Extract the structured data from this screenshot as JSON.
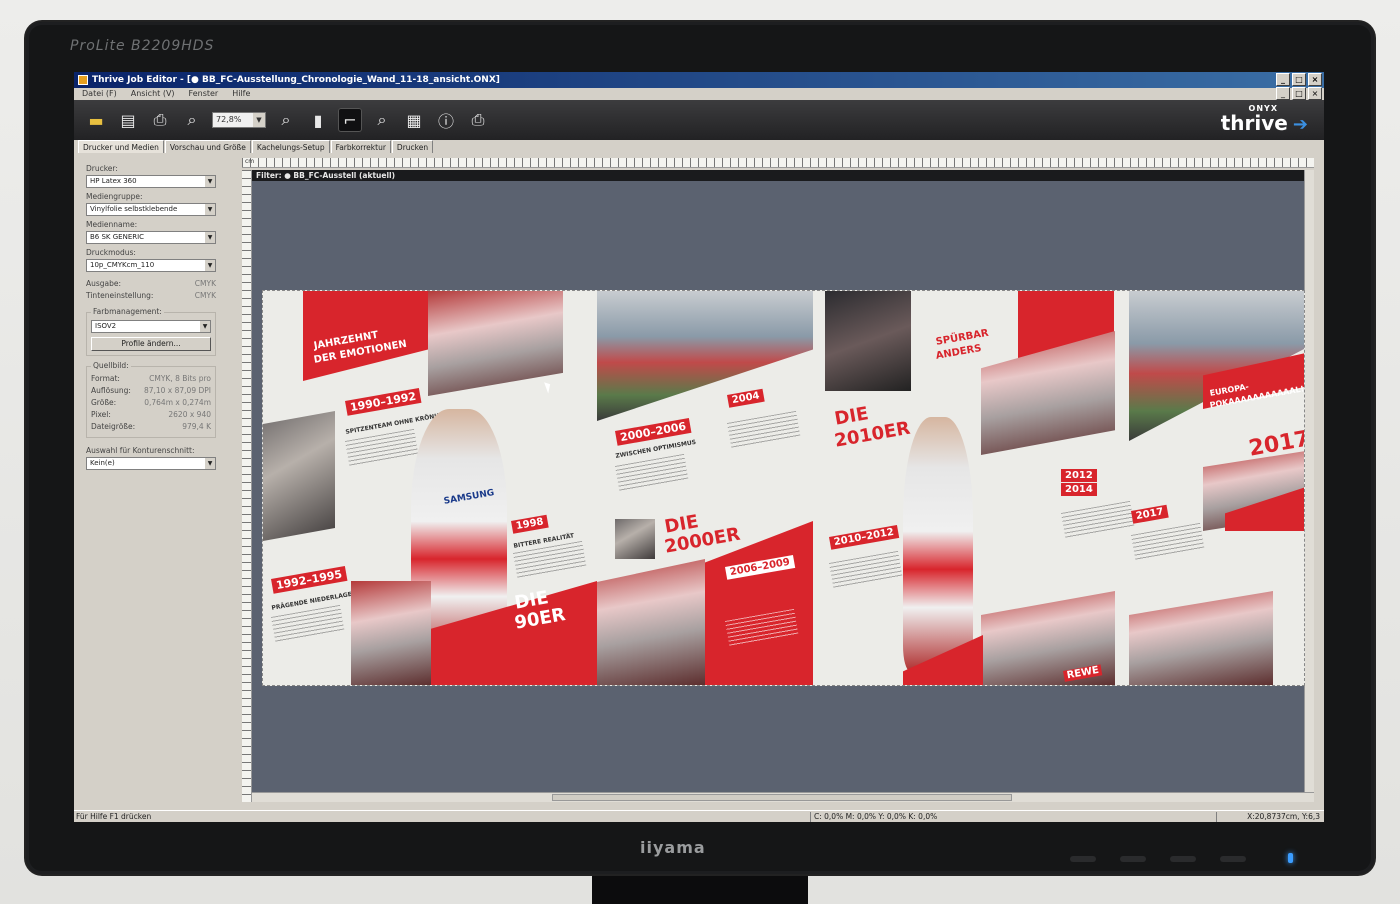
{
  "monitor": {
    "model": "ProLite B2209HDS",
    "brand": "iiyama"
  },
  "window": {
    "title": "Thrive Job Editor - [● BB_FC-Ausstellung_Chronologie_Wand_11-18_ansicht.ONX]",
    "controls": [
      "_",
      "□",
      "×"
    ]
  },
  "menu": {
    "items": [
      "Datei (F)",
      "Ansicht (V)",
      "Fenster",
      "Hilfe"
    ]
  },
  "toolbar": {
    "zoom": "72,8%",
    "logo_small": "ONYX",
    "logo_big": "thrive"
  },
  "tabs": [
    "Drucker und Medien",
    "Vorschau und Größe",
    "Kachelungs-Setup",
    "Farbkorrektur",
    "Drucken"
  ],
  "panel": {
    "drucker_label": "Drucker:",
    "drucker_value": "HP Latex 360",
    "mediengruppe_label": "Mediengruppe:",
    "mediengruppe_value": "Vinylfolie selbstklebende",
    "medienname_label": "Medienname:",
    "medienname_value": "B6 SK GENERIC",
    "druckmodus_label": "Druckmodus:",
    "druckmodus_value": "10p_CMYKcm_110",
    "ausgabe_label": "Ausgabe:",
    "ausgabe_value": "CMYK",
    "tinten_label": "Tinteneinstellung:",
    "tinten_value": "CMYK",
    "farbmanagement_title": "Farbmanagement:",
    "farbmanagement_value": "ISOV2",
    "profile_button": "Profile ändern...",
    "quellbild_title": "Quellbild:",
    "format_label": "Format:",
    "format_value": "CMYK, 8 Bits pro",
    "aufloesung_label": "Auflösung:",
    "aufloesung_value": "87,10 x 87,09 DPI",
    "groesse_label": "Größe:",
    "groesse_value": "0,764m x 0,274m",
    "pixel_label": "Pixel:",
    "pixel_value": "2620 x 940",
    "dateigroesse_label": "Dateigröße:",
    "dateigroesse_value": "979,4 K",
    "kontur_label": "Auswahl für Konturenschnitt:",
    "kontur_value": "Kein(e)"
  },
  "preview": {
    "ruler_unit": "cm",
    "filter": "Filter: ● BB_FC-Ausstell (aktuell)"
  },
  "poster": {
    "jahrzehnt": "JAHRZEHNT",
    "der_emotionen": "DER EMOTIONEN",
    "y1990": "1990–1992",
    "spitzenteam": "SPITZENTEAM OHNE KRÖNUNG",
    "y1992": "1992–1995",
    "praegende": "PRÄGENDE NIEDERLAGEN",
    "y1998": "1998",
    "bittere": "BITTERE REALITÄT",
    "die90_a": "DIE",
    "die90_b": "90ER",
    "y2000": "2000–2006",
    "zwischen": "ZWISCHEN OPTIMISMUS",
    "die2000_a": "DIE",
    "die2000_b": "2000ER",
    "y2004": "2004",
    "y2006": "2006–2009",
    "die2010_a": "DIE",
    "die2010_b": "2010ER",
    "y2010": "2010–2012",
    "spuerbar": "SPÜRBAR",
    "anders": "ANDERS",
    "y2012a": "2012",
    "y2012b": "2014",
    "y2017": "2017",
    "europa": "EUROPA-",
    "pokal": "POKAAAAAAAAAAAL!",
    "big2017": "2017",
    "rewe": "REWE",
    "samsung": "SAMSUNG"
  },
  "status": {
    "help": "Für Hilfe F1 drücken",
    "color": "C: 0,0%  M: 0,0%  Y: 0,0%  K: 0,0%",
    "coord": "X:20,8737cm, Y:6,3"
  }
}
